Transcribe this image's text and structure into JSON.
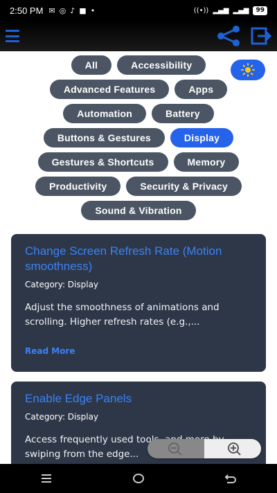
{
  "status": {
    "time": "2:50 PM",
    "notif_icons": [
      "gmail",
      "whatsapp",
      "tiktok",
      "app",
      "dot"
    ],
    "battery": "99"
  },
  "chips": [
    [
      "All",
      "Accessibility"
    ],
    [
      "Advanced Features",
      "Apps"
    ],
    [
      "Automation",
      "Battery"
    ],
    [
      "Buttons & Gestures",
      "Display"
    ],
    [
      "Gestures & Shortcuts",
      "Memory"
    ],
    [
      "Productivity",
      "Security & Privacy"
    ],
    [
      "Sound & Vibration"
    ]
  ],
  "active_chip": "Display",
  "cards": [
    {
      "title": "Change Screen Refresh Rate (Motion smoothness)",
      "category": "Category: Display",
      "description": "Adjust the smoothness of animations and scrolling. Higher refresh rates (e.g.,...",
      "read_more": "Read More"
    },
    {
      "title": "Enable Edge Panels",
      "category": "Category: Display",
      "description": "Access frequently used tools, and more by swiping from the edge..."
    }
  ],
  "colors": {
    "accent": "#2563eb",
    "chip": "#4b5563",
    "card": "#2d3748"
  }
}
